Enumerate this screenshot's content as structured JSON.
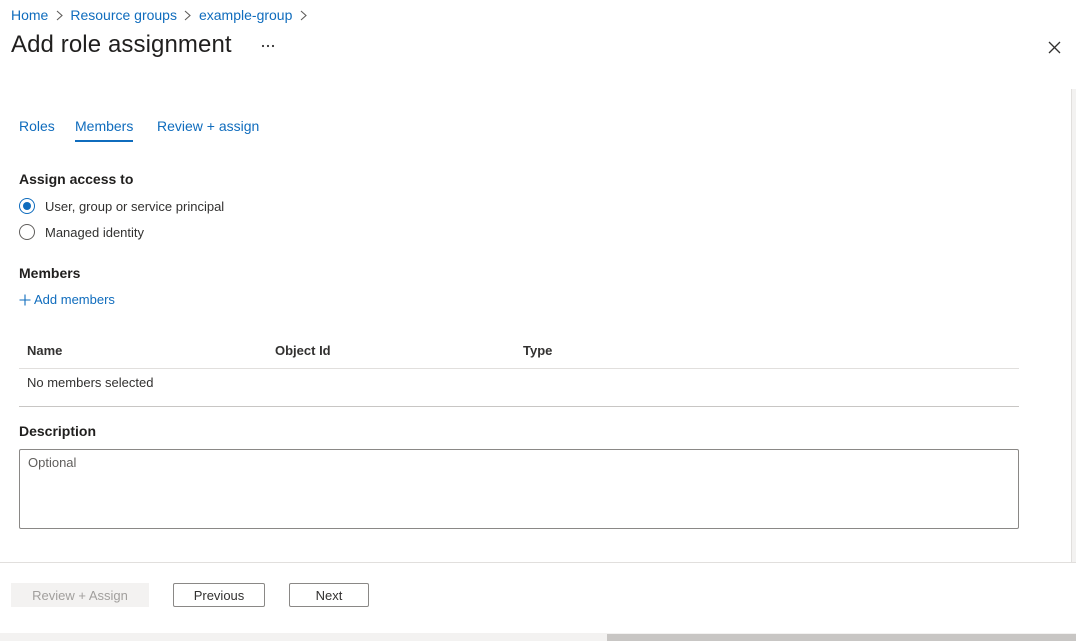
{
  "breadcrumb": {
    "items": [
      {
        "label": "Home"
      },
      {
        "label": "Resource groups"
      },
      {
        "label": "example-group"
      }
    ]
  },
  "header": {
    "title": "Add role assignment",
    "more_icon": "ellipsis-icon",
    "close_icon": "close-icon"
  },
  "tabs": [
    {
      "label": "Roles",
      "selected": false
    },
    {
      "label": "Members",
      "selected": true
    },
    {
      "label": "Review + assign",
      "selected": false
    }
  ],
  "assign_access": {
    "label": "Assign access to",
    "options": [
      {
        "label": "User, group or service principal",
        "checked": true
      },
      {
        "label": "Managed identity",
        "checked": false
      }
    ]
  },
  "members": {
    "label": "Members",
    "add_label": "Add members",
    "columns": [
      "Name",
      "Object Id",
      "Type"
    ],
    "empty_text": "No members selected"
  },
  "description": {
    "label": "Description",
    "placeholder": "Optional",
    "value": ""
  },
  "footer": {
    "review_assign_label": "Review + Assign",
    "previous_label": "Previous",
    "next_label": "Next"
  },
  "colors": {
    "accent": "#0f6cbd",
    "text": "#323130",
    "disabled_bg": "#f3f2f1",
    "disabled_text": "#a19f9d"
  }
}
